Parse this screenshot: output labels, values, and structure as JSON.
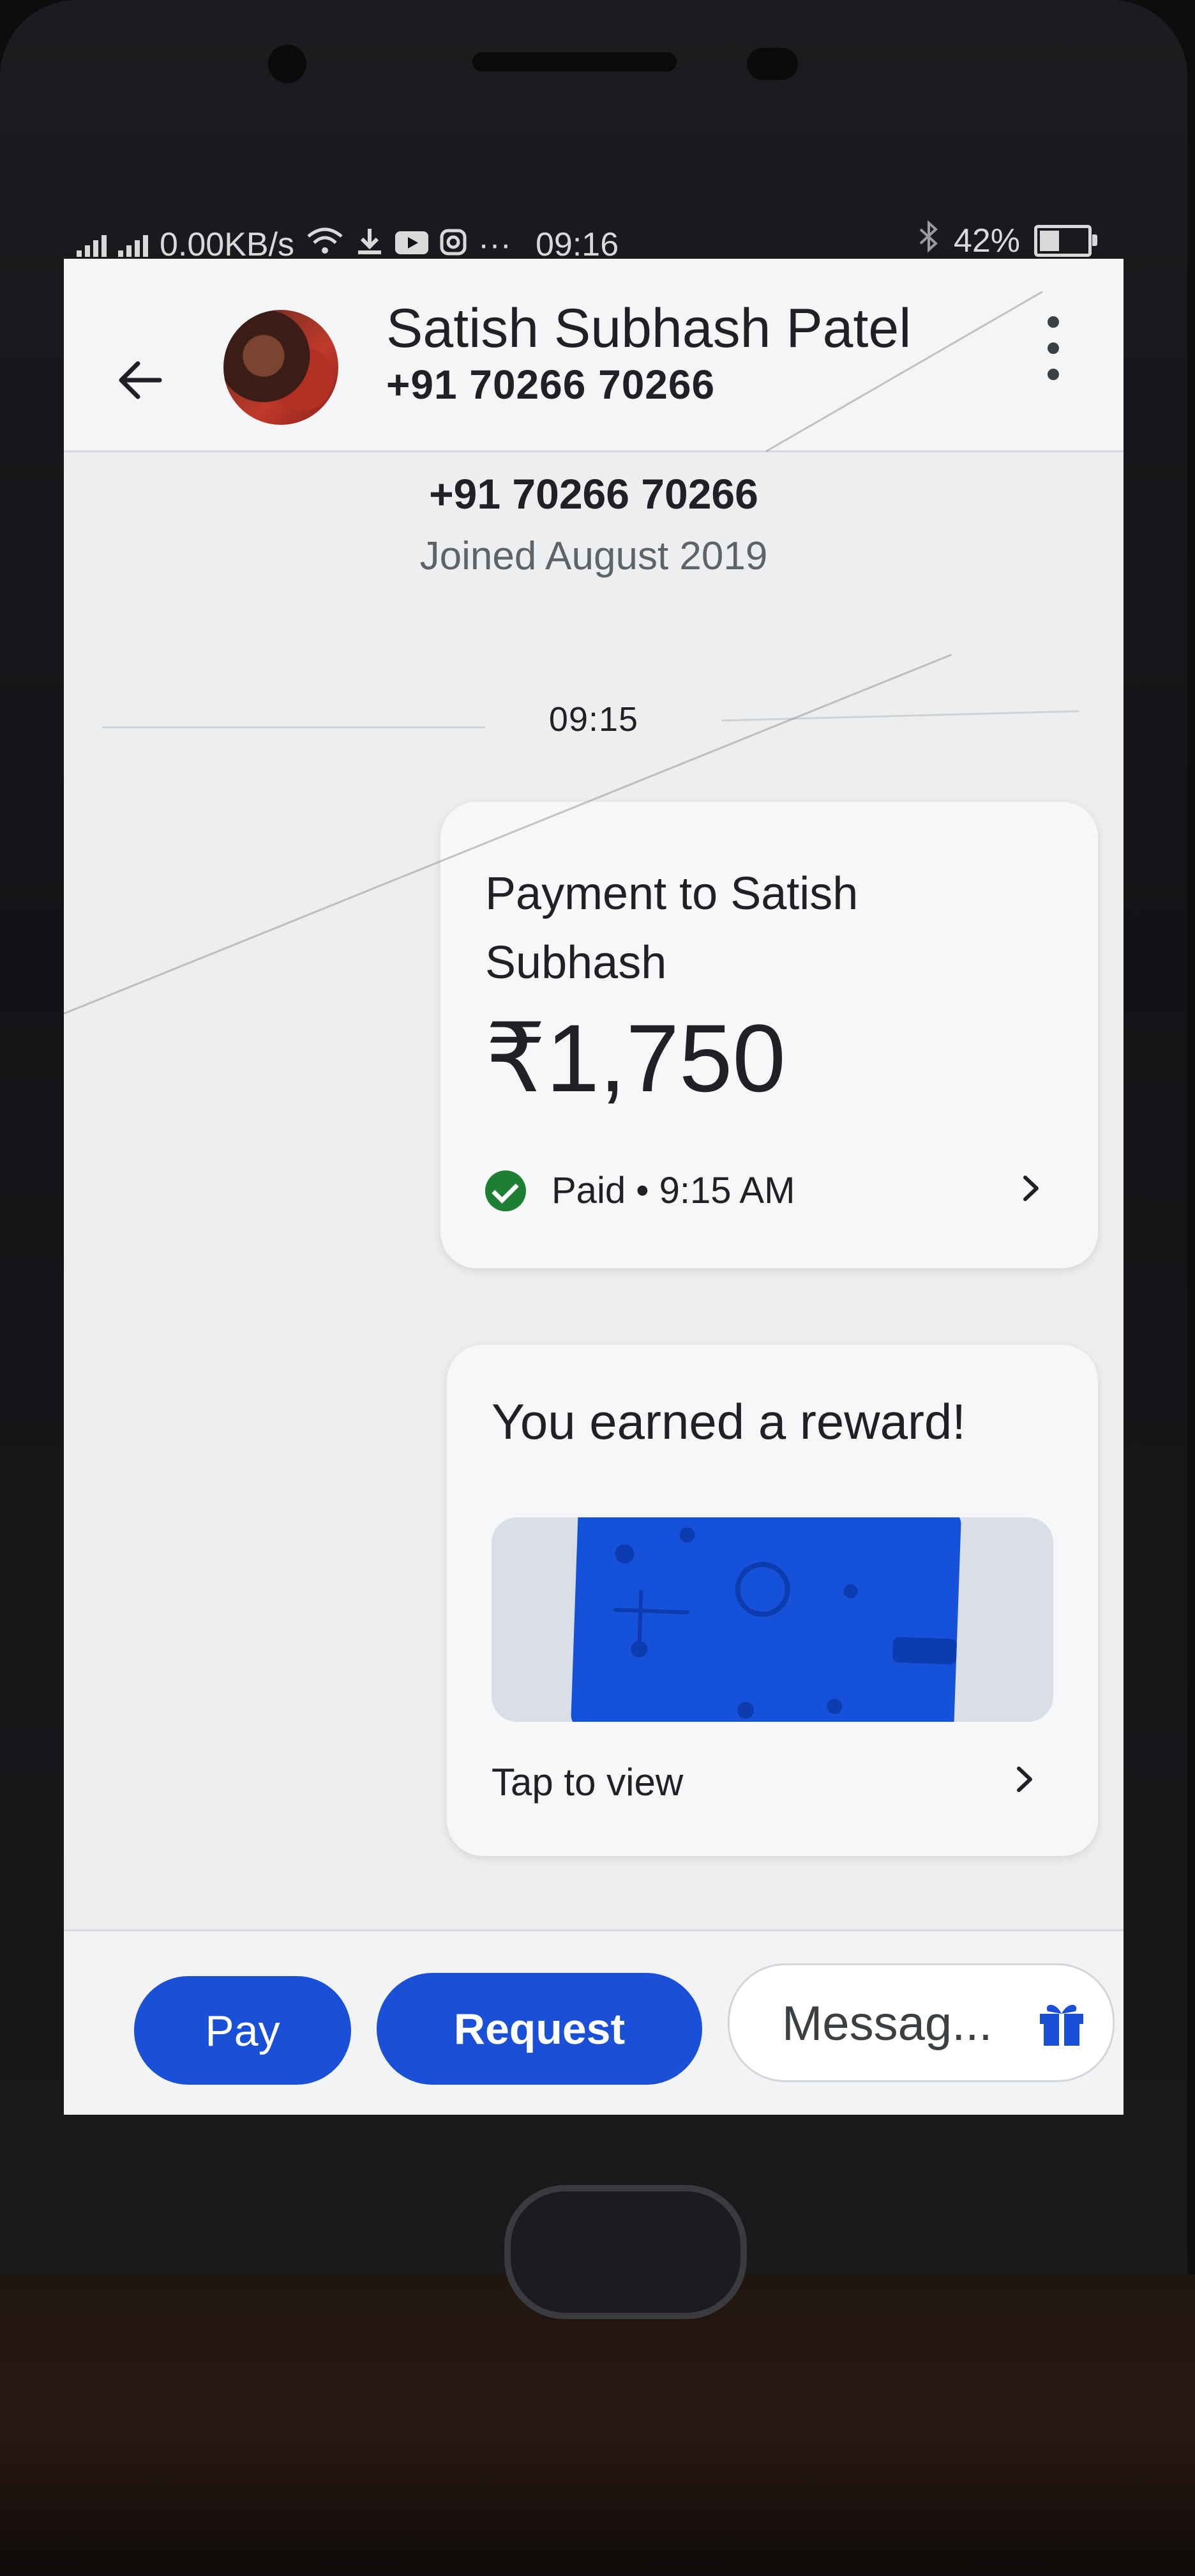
{
  "status_bar": {
    "network_speed": "0.00KB/s",
    "time": "09:16",
    "battery_percent": "42%",
    "battery_level": 0.42,
    "icons": [
      "signal-icon",
      "wifi-icon",
      "download-icon",
      "youtube-icon",
      "instagram-icon",
      "more-notifications-icon",
      "bluetooth-icon",
      "battery-icon"
    ]
  },
  "header": {
    "contact_name": "Satish Subhash Patel",
    "contact_phone": "+91 70266 70266"
  },
  "contact_info": {
    "phone": "+91 70266 70266",
    "joined": "Joined August 2019"
  },
  "conversation": {
    "timestamp": "09:15",
    "payment": {
      "title": "Payment to Satish Subhash",
      "amount": "₹1,750",
      "status": "Paid • 9:15 AM"
    },
    "reward": {
      "title": "You earned a reward!",
      "action": "Tap to view"
    }
  },
  "bottom_bar": {
    "pay_label": "Pay",
    "request_label": "Request",
    "message_placeholder": "Messag..."
  },
  "colors": {
    "accent_blue": "#1a4fd8",
    "success_green": "#1e7e34",
    "reward_blue": "#1551d9"
  }
}
